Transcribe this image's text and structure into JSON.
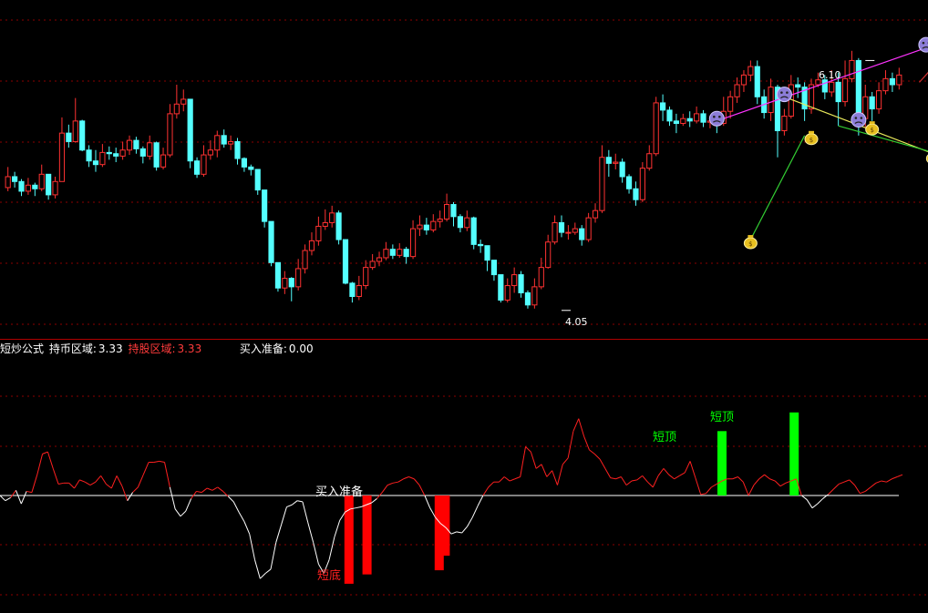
{
  "colors": {
    "background": "#000000",
    "grid": "#8b0000",
    "separator": "#b00000",
    "up_candle": "#ff3232",
    "down_candle": "#54ffff",
    "osc_above": "#ff2020",
    "osc_below": "#ffffff",
    "zero_line": "#ffffff",
    "buy_bar": "#ff0000",
    "top_bar": "#00ff00",
    "trend_magenta": "#ff33ff",
    "trend_green": "#33cc33",
    "trend_yellow": "#e8e85a",
    "trend_red": "#d03030",
    "annotation": "#ffffff"
  },
  "legend": {
    "name": "短炒公式",
    "hold_market_label": "持币区域:",
    "hold_market_value": "3.33",
    "hold_stock_label": "持股区域:",
    "hold_stock_value": "3.33",
    "buy_ready_label": "买入准备:",
    "buy_ready_value": "0.00"
  },
  "annotations": {
    "low_price": "4.05",
    "high_price": "6.10",
    "buy_ready": "买入准备",
    "short_bottom": "短底",
    "short_top": "短顶"
  },
  "icons": {
    "sell_signal": "angry-face-icon",
    "buy_signal": "money-bag-icon"
  },
  "chart_data": [
    {
      "type": "candlestick",
      "ylim": [
        3.8,
        6.6
      ],
      "grid": true,
      "low_marker": {
        "index": 82,
        "value": 4.05
      },
      "high_marker": {
        "index": 127,
        "value": 6.1
      },
      "candles": [
        [
          5.05,
          5.14,
          5.22,
          5.02
        ],
        [
          5.14,
          5.1,
          5.18,
          5.05
        ],
        [
          5.1,
          5.02,
          5.12,
          4.98
        ],
        [
          5.02,
          5.07,
          5.13,
          4.99
        ],
        [
          5.07,
          5.04,
          5.09,
          4.98
        ],
        [
          5.04,
          5.16,
          5.24,
          5.02
        ],
        [
          5.16,
          4.99,
          5.16,
          4.95
        ],
        [
          4.99,
          5.1,
          5.14,
          4.96
        ],
        [
          5.1,
          5.5,
          5.63,
          5.1
        ],
        [
          5.5,
          5.43,
          5.57,
          5.38
        ],
        [
          5.43,
          5.6,
          5.79,
          5.42
        ],
        [
          5.6,
          5.36,
          5.61,
          5.35
        ],
        [
          5.36,
          5.27,
          5.4,
          5.22
        ],
        [
          5.27,
          5.24,
          5.36,
          5.18
        ],
        [
          5.24,
          5.34,
          5.41,
          5.22
        ],
        [
          5.34,
          5.33,
          5.39,
          5.28
        ],
        [
          5.33,
          5.31,
          5.38,
          5.26
        ],
        [
          5.31,
          5.36,
          5.43,
          5.28
        ],
        [
          5.36,
          5.44,
          5.48,
          5.32
        ],
        [
          5.44,
          5.37,
          5.47,
          5.33
        ],
        [
          5.37,
          5.31,
          5.39,
          5.25
        ],
        [
          5.31,
          5.42,
          5.48,
          5.28
        ],
        [
          5.42,
          5.22,
          5.43,
          5.19
        ],
        [
          5.22,
          5.32,
          5.38,
          5.2
        ],
        [
          5.32,
          5.66,
          5.74,
          5.3
        ],
        [
          5.66,
          5.74,
          5.9,
          5.62
        ],
        [
          5.74,
          5.78,
          5.86,
          5.68
        ],
        [
          5.78,
          5.27,
          5.78,
          5.21
        ],
        [
          5.27,
          5.16,
          5.3,
          5.13
        ],
        [
          5.16,
          5.32,
          5.4,
          5.14
        ],
        [
          5.32,
          5.36,
          5.44,
          5.28
        ],
        [
          5.36,
          5.48,
          5.52,
          5.3
        ],
        [
          5.48,
          5.41,
          5.53,
          5.38
        ],
        [
          5.41,
          5.43,
          5.48,
          5.36
        ],
        [
          5.43,
          5.29,
          5.46,
          5.24
        ],
        [
          5.29,
          5.22,
          5.3,
          5.18
        ],
        [
          5.22,
          5.2,
          5.24,
          5.15
        ],
        [
          5.2,
          5.03,
          5.2,
          4.99
        ],
        [
          5.03,
          4.77,
          5.03,
          4.72
        ],
        [
          4.77,
          4.43,
          4.77,
          4.4
        ],
        [
          4.43,
          4.22,
          4.43,
          4.19
        ],
        [
          4.22,
          4.3,
          4.36,
          4.17
        ],
        [
          4.3,
          4.23,
          4.31,
          4.11
        ],
        [
          4.23,
          4.38,
          4.46,
          4.2
        ],
        [
          4.38,
          4.53,
          4.58,
          4.34
        ],
        [
          4.53,
          4.61,
          4.68,
          4.49
        ],
        [
          4.61,
          4.73,
          4.81,
          4.57
        ],
        [
          4.73,
          4.76,
          4.87,
          4.7
        ],
        [
          4.76,
          4.84,
          4.9,
          4.72
        ],
        [
          4.84,
          4.62,
          4.86,
          4.58
        ],
        [
          4.62,
          4.26,
          4.62,
          4.25
        ],
        [
          4.26,
          4.15,
          4.27,
          4.1
        ],
        [
          4.15,
          4.24,
          4.32,
          4.12
        ],
        [
          4.24,
          4.39,
          4.45,
          4.21
        ],
        [
          4.39,
          4.44,
          4.5,
          4.37
        ],
        [
          4.44,
          4.47,
          4.52,
          4.4
        ],
        [
          4.47,
          4.54,
          4.6,
          4.45
        ],
        [
          4.54,
          4.49,
          4.58,
          4.46
        ],
        [
          4.49,
          4.54,
          4.59,
          4.47
        ],
        [
          4.54,
          4.48,
          4.56,
          4.42
        ],
        [
          4.48,
          4.71,
          4.78,
          4.46
        ],
        [
          4.71,
          4.74,
          4.82,
          4.65
        ],
        [
          4.74,
          4.7,
          4.8,
          4.66
        ],
        [
          4.7,
          4.77,
          4.83,
          4.68
        ],
        [
          4.77,
          4.79,
          4.86,
          4.72
        ],
        [
          4.79,
          4.91,
          5.0,
          4.77
        ],
        [
          4.91,
          4.81,
          4.93,
          4.73
        ],
        [
          4.81,
          4.72,
          4.83,
          4.68
        ],
        [
          4.72,
          4.8,
          4.86,
          4.69
        ],
        [
          4.8,
          4.58,
          4.81,
          4.54
        ],
        [
          4.58,
          4.57,
          4.62,
          4.51
        ],
        [
          4.57,
          4.45,
          4.57,
          4.36
        ],
        [
          4.45,
          4.33,
          4.45,
          4.28
        ],
        [
          4.33,
          4.12,
          4.33,
          4.1
        ],
        [
          4.12,
          4.24,
          4.3,
          4.1
        ],
        [
          4.24,
          4.33,
          4.39,
          4.18
        ],
        [
          4.33,
          4.18,
          4.36,
          4.14
        ],
        [
          4.18,
          4.08,
          4.2,
          4.05
        ],
        [
          4.08,
          4.23,
          4.3,
          4.05
        ],
        [
          4.23,
          4.39,
          4.47,
          4.21
        ],
        [
          4.39,
          4.6,
          4.66,
          4.38
        ],
        [
          4.6,
          4.76,
          4.82,
          4.58
        ],
        [
          4.76,
          4.68,
          4.82,
          4.64
        ],
        [
          4.68,
          4.68,
          4.74,
          4.62
        ],
        [
          4.68,
          4.71,
          4.76,
          4.66
        ],
        [
          4.71,
          4.62,
          4.74,
          4.57
        ],
        [
          4.62,
          4.8,
          4.84,
          4.6
        ],
        [
          4.8,
          4.86,
          4.92,
          4.76
        ],
        [
          4.86,
          5.3,
          5.4,
          4.84
        ],
        [
          5.3,
          5.25,
          5.36,
          5.14
        ],
        [
          5.25,
          5.26,
          5.33,
          5.2
        ],
        [
          5.26,
          5.14,
          5.29,
          5.09
        ],
        [
          5.14,
          5.04,
          5.16,
          5.0
        ],
        [
          5.04,
          4.95,
          5.1,
          4.9
        ],
        [
          4.95,
          5.21,
          5.26,
          4.93
        ],
        [
          5.21,
          5.33,
          5.4,
          5.19
        ],
        [
          5.33,
          5.75,
          5.8,
          5.31
        ],
        [
          5.75,
          5.69,
          5.82,
          5.6
        ],
        [
          5.69,
          5.6,
          5.72,
          5.56
        ],
        [
          5.6,
          5.58,
          5.66,
          5.5
        ],
        [
          5.58,
          5.62,
          5.66,
          5.56
        ],
        [
          5.62,
          5.6,
          5.68,
          5.55
        ],
        [
          5.6,
          5.66,
          5.72,
          5.58
        ],
        [
          5.66,
          5.59,
          5.69,
          5.55
        ],
        [
          5.59,
          5.6,
          5.64,
          5.54
        ],
        [
          5.6,
          5.58,
          5.64,
          5.5
        ],
        [
          5.58,
          5.68,
          5.8,
          5.56
        ],
        [
          5.68,
          5.8,
          5.85,
          5.62
        ],
        [
          5.8,
          5.9,
          5.96,
          5.75
        ],
        [
          5.9,
          5.98,
          6.02,
          5.84
        ],
        [
          5.98,
          6.05,
          6.1,
          5.93
        ],
        [
          6.05,
          5.8,
          6.1,
          5.74
        ],
        [
          5.8,
          5.67,
          5.86,
          5.62
        ],
        [
          5.67,
          5.88,
          5.95,
          5.6
        ],
        [
          5.88,
          5.52,
          5.9,
          5.3
        ],
        [
          5.52,
          5.64,
          5.7,
          5.48
        ],
        [
          5.64,
          5.9,
          5.98,
          5.62
        ],
        [
          5.9,
          5.88,
          5.96,
          5.79
        ],
        [
          5.88,
          5.7,
          5.92,
          5.6
        ],
        [
          5.7,
          5.9,
          5.95,
          5.66
        ],
        [
          5.9,
          5.94,
          6.0,
          5.88
        ],
        [
          5.94,
          5.84,
          5.98,
          5.78
        ],
        [
          5.84,
          5.92,
          6.02,
          5.8
        ],
        [
          5.92,
          5.76,
          6.0,
          5.56
        ],
        [
          5.76,
          5.95,
          6.1,
          5.72
        ],
        [
          5.95,
          6.1,
          6.18,
          5.92
        ],
        [
          6.1,
          5.62,
          6.12,
          5.48
        ],
        [
          5.62,
          5.8,
          5.9,
          5.55
        ],
        [
          5.8,
          5.7,
          5.84,
          5.6
        ],
        [
          5.7,
          5.85,
          5.92,
          5.66
        ],
        [
          5.85,
          5.95,
          6.02,
          5.82
        ],
        [
          5.95,
          5.9,
          6.0,
          5.84
        ],
        [
          5.9,
          5.98,
          6.04,
          5.86
        ]
      ],
      "trend_lines": [
        {
          "color_key": "trend_magenta",
          "from": [
            105,
            5.6
          ],
          "to": [
            146,
            6.4
          ]
        },
        {
          "color_key": "trend_green",
          "from": [
            110,
            4.62
          ],
          "to": [
            118,
            5.48
          ]
        },
        {
          "color_key": "trend_yellow",
          "from": [
            115,
            5.8
          ],
          "to": [
            146,
            5.14
          ]
        },
        {
          "color_key": "trend_green",
          "from": [
            123,
            5.56
          ],
          "to": [
            146,
            5.2
          ]
        },
        {
          "color_key": "trend_red",
          "from": [
            135,
            5.92
          ],
          "to": [
            146,
            6.6
          ]
        }
      ],
      "sell_icons": [
        {
          "index": 105,
          "value": 5.62
        },
        {
          "index": 115,
          "value": 5.82
        },
        {
          "index": 126,
          "value": 5.61
        },
        {
          "index": 136,
          "value": 6.23
        }
      ],
      "buy_icons": [
        {
          "index": 110,
          "value": 4.62
        },
        {
          "index": 119,
          "value": 5.48
        },
        {
          "index": 128,
          "value": 5.56
        },
        {
          "index": 137,
          "value": 5.32
        }
      ]
    },
    {
      "type": "line",
      "ylim": [
        -10,
        10
      ],
      "grid": true,
      "zero": 0,
      "values": [
        0.0,
        -0.5,
        -0.2,
        0.5,
        -0.8,
        0.4,
        0.3,
        2.0,
        4.0,
        4.2,
        2.6,
        1.1,
        1.2,
        1.2,
        0.7,
        1.5,
        1.3,
        1.0,
        1.3,
        1.9,
        1.1,
        0.7,
        1.9,
        0.9,
        -0.5,
        0.3,
        0.8,
        2.0,
        3.2,
        3.2,
        3.3,
        3.2,
        0.8,
        -1.3,
        -2.0,
        -1.5,
        -0.3,
        0.4,
        0.3,
        0.7,
        0.5,
        0.8,
        0.4,
        -0.1,
        -0.6,
        -1.6,
        -2.5,
        -3.7,
        -6.2,
        -8.0,
        -7.5,
        -7.1,
        -4.5,
        -2.8,
        -1.1,
        -0.9,
        -0.5,
        -0.6,
        -2.6,
        -4.5,
        -6.6,
        -7.5,
        -6.2,
        -4.0,
        -2.4,
        -1.6,
        -1.3,
        -1.2,
        -1.1,
        -0.9,
        -0.7,
        -0.3,
        0.3,
        1.0,
        1.2,
        1.3,
        1.6,
        1.8,
        1.6,
        1.0,
        0.0,
        -1.2,
        -2.1,
        -2.7,
        -3.1,
        -3.7,
        -3.5,
        -3.6,
        -3.0,
        -2.1,
        -1.0,
        0.0,
        0.8,
        1.3,
        1.3,
        1.8,
        1.4,
        1.6,
        1.8,
        4.7,
        4.2,
        2.6,
        3.0,
        1.8,
        2.4,
        1.0,
        3.0,
        3.6,
        6.2,
        7.4,
        5.7,
        4.4,
        4.0,
        3.5,
        2.6,
        1.7,
        1.6,
        1.8,
        1.0,
        1.4,
        1.5,
        1.9,
        1.3,
        0.8,
        1.9,
        2.6,
        2.0,
        1.6,
        1.9,
        2.2,
        3.3,
        1.7,
        0.1,
        0.2,
        0.8,
        1.1,
        1.4,
        1.6,
        1.6,
        1.8,
        1.3,
        0.0,
        1.0,
        1.6,
        2.0,
        1.6,
        1.4,
        0.9,
        1.2,
        1.4,
        1.6,
        0.0,
        -0.4,
        -1.2,
        -0.8,
        -0.3,
        0.1,
        0.6,
        1.1,
        1.3,
        1.5,
        1.0,
        0.2,
        0.4,
        0.8,
        1.2,
        1.4,
        1.3,
        1.6,
        1.8,
        2.0
      ],
      "buy_bars": [
        {
          "x": 58,
          "from": 0,
          "to": -8.5
        },
        {
          "x": 61,
          "from": 0,
          "to": -7.6
        },
        {
          "x": 73,
          "from": 0,
          "to": -7.2
        },
        {
          "x": 74,
          "from": 0,
          "to": -5.8
        }
      ],
      "top_bars": [
        {
          "x": 120,
          "from": 0,
          "to": 6.2
        },
        {
          "x": 132,
          "from": 0,
          "to": 8.0
        }
      ]
    }
  ]
}
